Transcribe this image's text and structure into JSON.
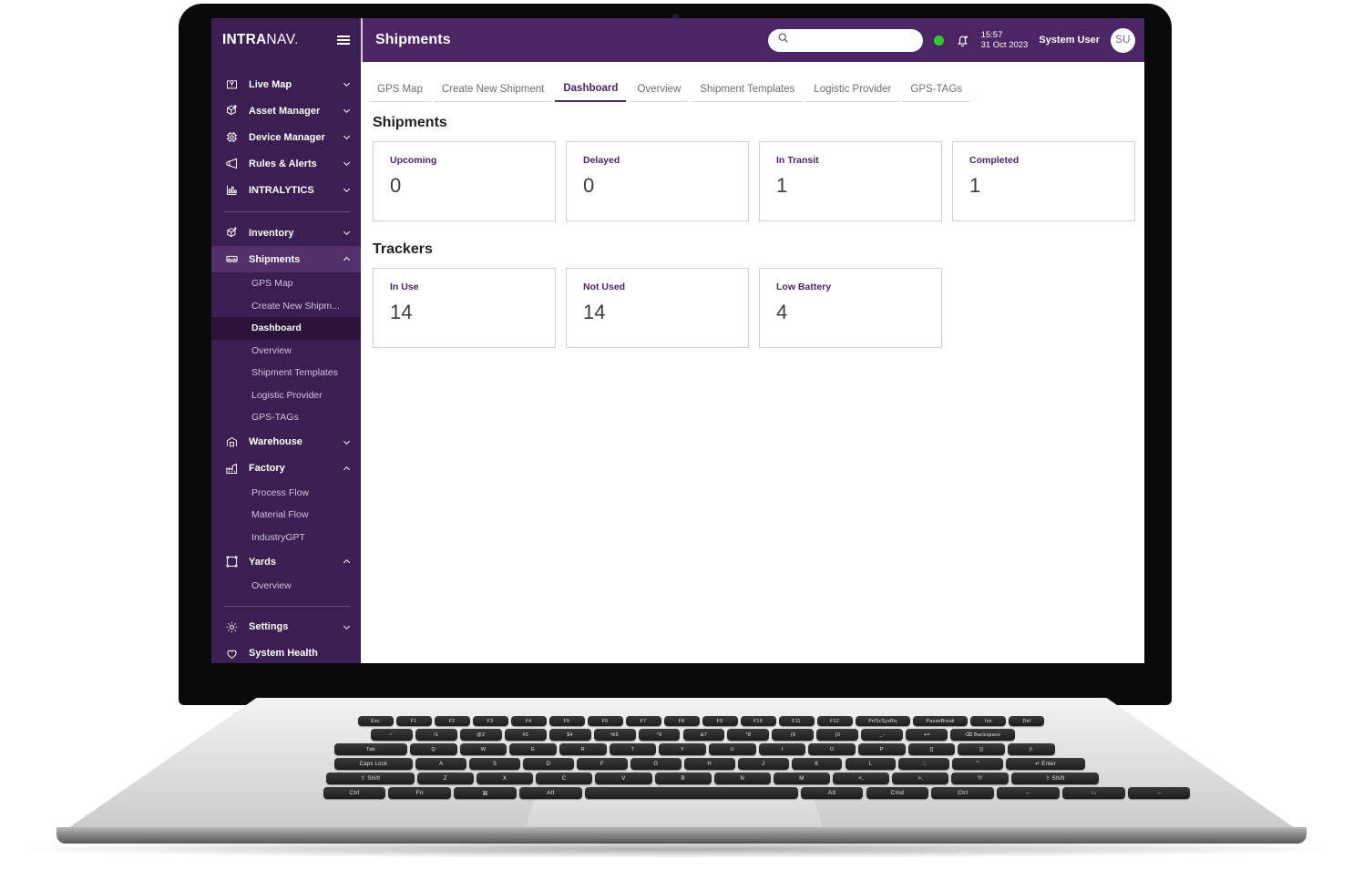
{
  "sidebar": {
    "brand": {
      "bold": "INTRA",
      "light": "NAV."
    },
    "menu_icon": "hamburger-icon",
    "top_items": [
      {
        "label": "Live Map",
        "icon": "map-pin-icon",
        "chevron": "chevron-down-icon"
      },
      {
        "label": "Asset Manager",
        "icon": "cube-plus-icon",
        "chevron": "chevron-down-icon"
      },
      {
        "label": "Device Manager",
        "icon": "chip-icon",
        "chevron": "chevron-down-icon"
      },
      {
        "label": "Rules & Alerts",
        "icon": "megaphone-icon",
        "chevron": "chevron-down-icon"
      },
      {
        "label": "INTRALYTICS",
        "icon": "bar-chart-icon",
        "chevron": "chevron-down-icon"
      }
    ],
    "groups": [
      {
        "label": "Inventory",
        "icon": "box-plus-icon",
        "chevron": "chevron-down-icon",
        "expanded": false,
        "children": []
      },
      {
        "label": "Shipments",
        "icon": "truck-icon",
        "chevron": "chevron-up-icon",
        "expanded": true,
        "active": true,
        "children": [
          "GPS Map",
          "Create New Shipm...",
          "Dashboard",
          "Overview",
          "Shipment Templates",
          "Logistic Provider",
          "GPS-TAGs"
        ],
        "current_child": "Dashboard"
      },
      {
        "label": "Warehouse",
        "icon": "warehouse-icon",
        "chevron": "chevron-down-icon",
        "expanded": false,
        "children": []
      },
      {
        "label": "Factory",
        "icon": "factory-icon",
        "chevron": "chevron-up-icon",
        "expanded": true,
        "children": [
          "Process Flow",
          "Material Flow",
          "IndustryGPT"
        ]
      },
      {
        "label": "Yards",
        "icon": "yard-icon",
        "chevron": "chevron-up-icon",
        "expanded": true,
        "children": [
          "Overview"
        ]
      }
    ],
    "footer_items": [
      {
        "label": "Settings",
        "icon": "gear-icon",
        "chevron": "chevron-down-icon"
      },
      {
        "label": "System Health",
        "icon": "heart-icon",
        "chevron": ""
      }
    ]
  },
  "topbar": {
    "title": "Shipments",
    "search_placeholder": "",
    "search_value": "",
    "search_icon": "search-icon",
    "status_dot_color": "#35c82f",
    "bell_icon": "bell-icon",
    "time": "15:57",
    "date": "31 Oct 2023",
    "username": "System User",
    "avatar_initials": "SU"
  },
  "tabs": [
    {
      "label": "GPS Map",
      "active": false
    },
    {
      "label": "Create New Shipment",
      "active": false
    },
    {
      "label": "Dashboard",
      "active": true
    },
    {
      "label": "Overview",
      "active": false
    },
    {
      "label": "Shipment Templates",
      "active": false
    },
    {
      "label": "Logistic Provider",
      "active": false
    },
    {
      "label": "GPS-TAGs",
      "active": false
    }
  ],
  "sections": [
    {
      "title": "Shipments",
      "cards": [
        {
          "label": "Upcoming",
          "value": "0"
        },
        {
          "label": "Delayed",
          "value": "0"
        },
        {
          "label": "In Transit",
          "value": "1"
        },
        {
          "label": "Completed",
          "value": "1"
        }
      ]
    },
    {
      "title": "Trackers",
      "cards": [
        {
          "label": "In Use",
          "value": "14"
        },
        {
          "label": "Not Used",
          "value": "14"
        },
        {
          "label": "Low Battery",
          "value": "4"
        }
      ]
    }
  ],
  "theme": {
    "sidebar_bg": "#3b1f52",
    "topbar_bg": "#4b2564",
    "accent": "#4b2564",
    "active_sub_bg": "#2a1239",
    "card_border": "#d5cdd9",
    "status_green": "#35c82f"
  },
  "keyboard": {
    "row_fn": [
      "Esc",
      "F1",
      "F2",
      "F3",
      "F4",
      "F5",
      "F6",
      "F7",
      "F8",
      "F9",
      "F10",
      "F11",
      "F12",
      "PrtScSysRq",
      "PauseBreak",
      "Ins",
      "Del"
    ],
    "row_num": [
      "~`",
      "!1",
      "@2",
      "#3",
      "$4",
      "%5",
      "^6",
      "&7",
      "*8",
      "(9",
      ")0",
      "_-",
      "+=",
      "⌫ Backspace"
    ],
    "row_q": [
      "Tab",
      "Q",
      "W",
      "E",
      "R",
      "T",
      "Y",
      "U",
      "I",
      "O",
      "P",
      "{[",
      "}]",
      "|\\"
    ],
    "row_a": [
      "Caps Lock",
      "A",
      "S",
      "D",
      "F",
      "G",
      "H",
      "J",
      "K",
      "L",
      ":;",
      "\"'",
      "↵ Enter"
    ],
    "row_z": [
      "⇧ Shift",
      "Z",
      "X",
      "C",
      "V",
      "B",
      "N",
      "M",
      "<,",
      ">.",
      "?/",
      "⇧ Shift"
    ],
    "row_ctrl": [
      "Ctrl",
      "Fn",
      "⌘",
      "Alt",
      "",
      "Alt",
      "Cmd",
      "Ctrl",
      "←",
      "↑↓",
      "→"
    ]
  }
}
